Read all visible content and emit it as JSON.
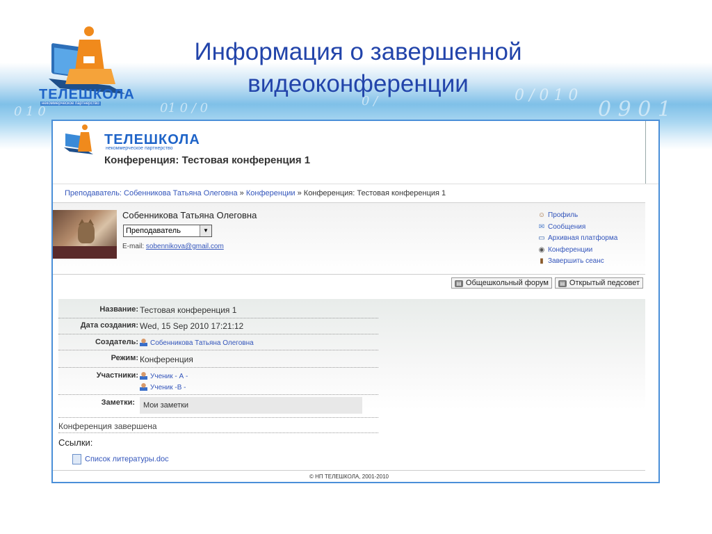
{
  "slide": {
    "title_line1": "Информация о завершенной",
    "title_line2": "видеоконференции",
    "logo_text": "ТЕЛЕШКОЛА",
    "logo_sub": "некоммерческое партнерство"
  },
  "header": {
    "brand": "ТЕЛЕШКОЛА",
    "brand_sub": "некоммерческое партнерство",
    "conference_title": "Конференция: Тестовая конференция 1"
  },
  "breadcrumb": {
    "items": [
      "Преподаватель: Собенникова Татьяна Олеговна",
      "Конференции",
      "Конференция: Тестовая конференция 1"
    ],
    "separator": "»"
  },
  "user": {
    "name": "Собенникова Татьяна Олеговна",
    "role_selected": "Преподаватель",
    "email_label": "E-mail:",
    "email": "sobennikova@gmail.com"
  },
  "menu": {
    "items": [
      {
        "label": "Профиль",
        "icon": "profile-icon"
      },
      {
        "label": "Сообщения",
        "icon": "mail-icon"
      },
      {
        "label": "Архивная платформа",
        "icon": "window-icon"
      },
      {
        "label": "Конференции",
        "icon": "webcam-icon"
      },
      {
        "label": "Завершить сеанс",
        "icon": "door-icon"
      }
    ]
  },
  "forums": {
    "school_forum": "Общешкольный форум",
    "open_council": "Открытый педсовет"
  },
  "info": {
    "name_label": "Название:",
    "name_value": "Тестовая конференция 1",
    "created_label": "Дата создания:",
    "created_value": "Wed, 15 Sep 2010 17:21:12",
    "creator_label": "Создатель:",
    "creator_value": "Собенникова Татьяна Олеговна",
    "mode_label": "Режим:",
    "mode_value": "Конференция",
    "participants_label": "Участники:",
    "participants": [
      "Ученик - А -",
      "Ученик -В -"
    ],
    "notes_label": "Заметки:",
    "notes_value": "Мои заметки"
  },
  "status": "Конференция завершена",
  "links": {
    "heading": "Ссылки:",
    "doc": "Список литературы.doc"
  },
  "footer": "© НП ТЕЛЕШКОЛА, 2001-2010",
  "colors": {
    "slide_title": "#2244aa",
    "frame_border": "#4a8fd8",
    "link": "#3355bb",
    "brand": "#1f64c8"
  }
}
